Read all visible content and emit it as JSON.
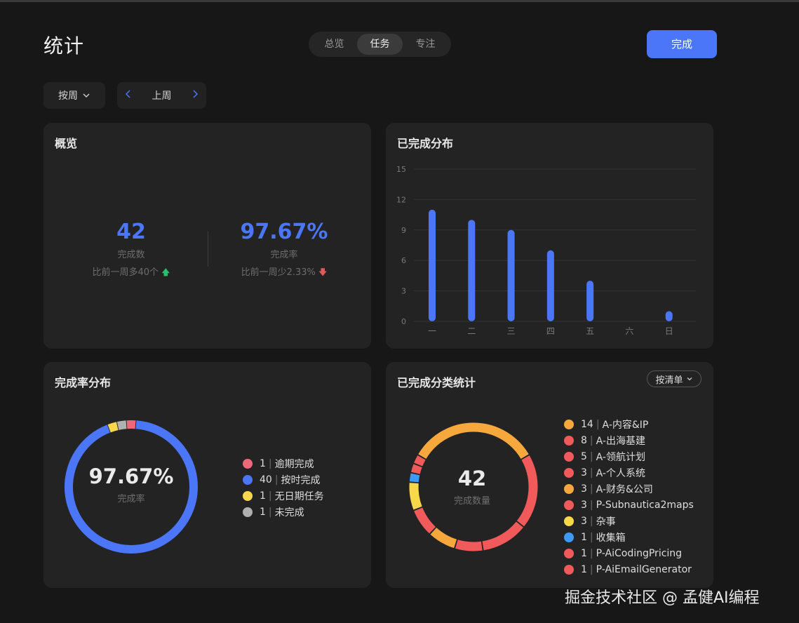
{
  "header": {
    "title": "统计",
    "done_label": "完成"
  },
  "tabs": [
    {
      "label": "总览",
      "active": false
    },
    {
      "label": "任务",
      "active": true
    },
    {
      "label": "专注",
      "active": false
    }
  ],
  "filters": {
    "period_label": "按周",
    "range_label": "上周"
  },
  "overview": {
    "title": "概览",
    "count": {
      "value": "42",
      "label": "完成数",
      "compare": "比前一周多40个"
    },
    "rate": {
      "value": "97.67%",
      "label": "完成率",
      "compare": "比前一周少2.33%"
    }
  },
  "distribution": {
    "title": "已完成分布",
    "chart_data": {
      "type": "bar",
      "title": "已完成分布",
      "categories": [
        "一",
        "二",
        "三",
        "四",
        "五",
        "六",
        "日"
      ],
      "values": [
        11,
        10,
        9,
        7,
        4,
        0,
        1
      ],
      "yticks": [
        0,
        3,
        6,
        9,
        12,
        15
      ],
      "ylim": [
        0,
        15
      ],
      "grid": true,
      "color": "#4a76f7"
    }
  },
  "rate_dist": {
    "title": "完成率分布",
    "center_value": "97.67%",
    "center_label": "完成率",
    "items": [
      {
        "count": "1",
        "label": "逾期完成",
        "color": "#f0677a"
      },
      {
        "count": "40",
        "label": "按时完成",
        "color": "#4a76f7"
      },
      {
        "count": "1",
        "label": "无日期任务",
        "color": "#f7d84a"
      },
      {
        "count": "1",
        "label": "未完成",
        "color": "#b0b0b0"
      }
    ]
  },
  "category": {
    "title": "已完成分类统计",
    "dropdown_label": "按清单",
    "center_value": "42",
    "center_label": "完成数量",
    "items": [
      {
        "count": "14",
        "label": "A-内容&IP",
        "color": "#f7a83c"
      },
      {
        "count": "8",
        "label": "A-出海基建",
        "color": "#f05a5a"
      },
      {
        "count": "5",
        "label": "A-领航计划",
        "color": "#f05a5a"
      },
      {
        "count": "3",
        "label": "A-个人系统",
        "color": "#f05a5a"
      },
      {
        "count": "3",
        "label": "A-财务&公司",
        "color": "#f7a83c"
      },
      {
        "count": "3",
        "label": "P-Subnautica2maps",
        "color": "#f05a5a"
      },
      {
        "count": "3",
        "label": "杂事",
        "color": "#f7d84a"
      },
      {
        "count": "1",
        "label": "收集箱",
        "color": "#3d9af5"
      },
      {
        "count": "1",
        "label": "P-AiCodingPricing",
        "color": "#f05a5a"
      },
      {
        "count": "1",
        "label": "P-AiEmailGenerator",
        "color": "#f05a5a"
      }
    ]
  },
  "watermark": "掘金技术社区 @ 孟健AI编程"
}
